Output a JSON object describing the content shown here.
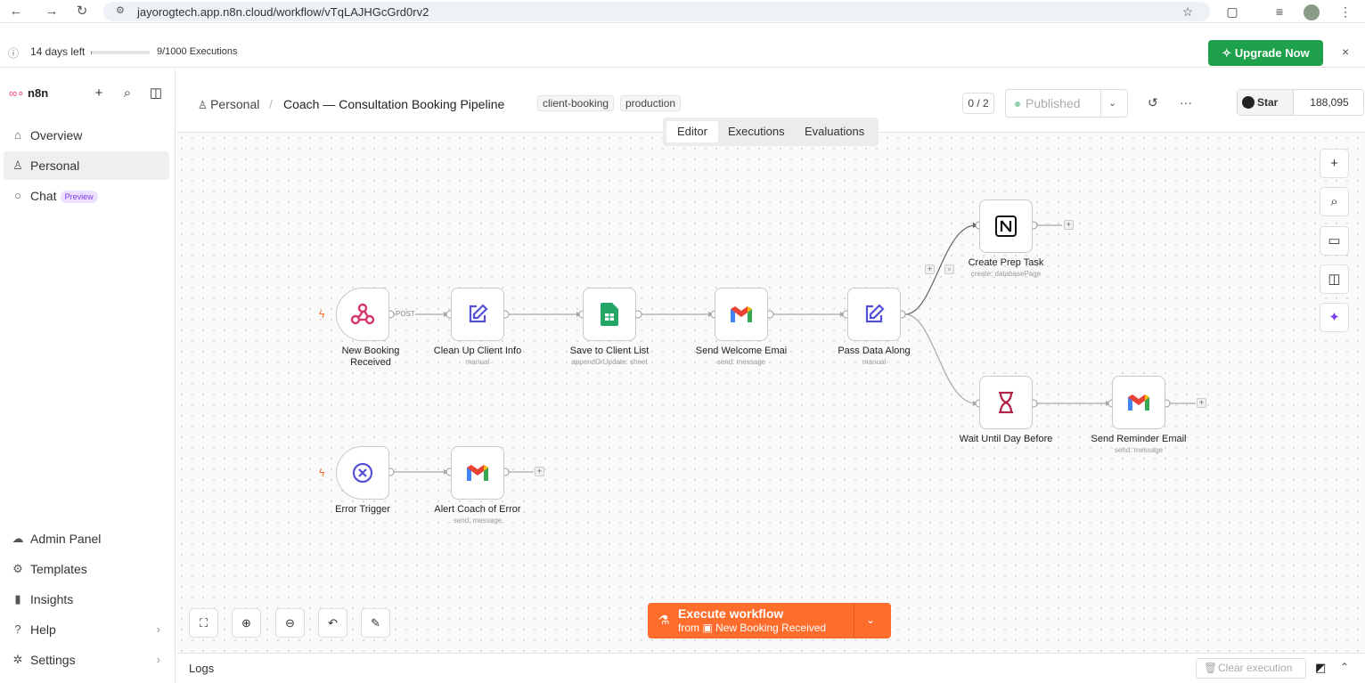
{
  "browser": {
    "url": "jayorogtech.app.n8n.cloud/workflow/vTqLAJHGcGrd0rv2",
    "icons": [
      "back-icon",
      "forward-icon",
      "reload-icon",
      "site-settings-icon",
      "star-icon",
      "extensions-icon",
      "media-icon",
      "profile-avatar",
      "menu-icon"
    ]
  },
  "trial": {
    "days_left": "14 days left",
    "executions": "9/1000 Executions",
    "executions_used": 9,
    "executions_total": 1000,
    "upgrade_label": "Upgrade Now",
    "close": "×"
  },
  "sidebar": {
    "brand": "n8n",
    "items": [
      {
        "label": "Overview",
        "icon": "home-icon"
      },
      {
        "label": "Personal",
        "icon": "user-icon",
        "active": true
      },
      {
        "label": "Chat",
        "icon": "chat-icon",
        "badge": "Preview"
      }
    ],
    "bottom_items": [
      {
        "label": "Admin Panel",
        "icon": "cloud-icon"
      },
      {
        "label": "Templates",
        "icon": "templates-icon"
      },
      {
        "label": "Insights",
        "icon": "insights-icon"
      },
      {
        "label": "Help",
        "icon": "help-icon"
      },
      {
        "label": "Settings",
        "icon": "settings-icon"
      }
    ]
  },
  "header": {
    "project": "Personal",
    "separator": "/",
    "workflow_name": "Coach — Consultation Booking Pipeline",
    "tags": [
      "client-booking",
      "production"
    ],
    "counter": "0 / 2",
    "publish_status": "Published",
    "github": {
      "star_label": "Star",
      "count": "188,095"
    }
  },
  "tabs": [
    "Editor",
    "Executions",
    "Evaluations"
  ],
  "active_tab": "Editor",
  "canvas": {
    "nodes": [
      {
        "name": "New Booking Received",
        "line1": "New Booking",
        "line2": "Received",
        "icon": "webhook-icon",
        "sub": ""
      },
      {
        "name": "Clean Up Client Info",
        "icon": "edit-icon",
        "sub": "manual"
      },
      {
        "name": "Save to Client List",
        "icon": "google-sheets-icon",
        "sub": "appendOrUpdate: sheet"
      },
      {
        "name": "Send Welcome Emai",
        "icon": "gmail-icon",
        "sub": "send: message"
      },
      {
        "name": "Pass Data Along",
        "icon": "edit-icon",
        "sub": "manual"
      },
      {
        "name": "Create Prep Task",
        "icon": "notion-icon",
        "sub": "create: databasePage"
      },
      {
        "name": "Wait Until Day Before",
        "icon": "hourglass-icon",
        "sub": ""
      },
      {
        "name": "Send Reminder Email",
        "icon": "gmail-icon",
        "sub": "send: message"
      },
      {
        "name": "Error Trigger",
        "icon": "error-trigger-icon",
        "sub": ""
      },
      {
        "name": "Alert Coach of Error",
        "icon": "gmail-icon",
        "sub": "send: message"
      }
    ],
    "edge_label": "POST",
    "execute": {
      "title": "Execute workflow",
      "from": "from",
      "trigger": "New Booking Received"
    }
  },
  "logs": {
    "label": "Logs",
    "clear": "Clear execution"
  }
}
